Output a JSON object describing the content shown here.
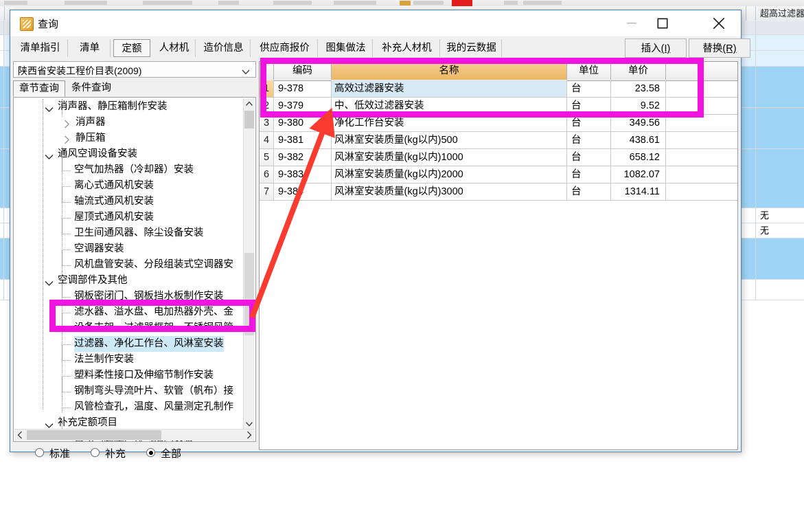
{
  "dialog": {
    "title": "查询",
    "window_buttons": {
      "minimize": "minimize-icon",
      "maximize": "maximize-icon",
      "close": "close-icon"
    },
    "tabs": [
      {
        "label": "清单指引",
        "active": false
      },
      {
        "label": "清单",
        "active": false
      },
      {
        "label": "定额",
        "active": true
      },
      {
        "label": "人材机",
        "active": false
      },
      {
        "label": "造价信息",
        "active": false
      },
      {
        "label": "供应商报价",
        "active": false
      },
      {
        "label": "图集做法",
        "active": false
      },
      {
        "label": "补充人材机",
        "active": false
      },
      {
        "label": "我的云数据",
        "active": false
      }
    ],
    "actions": [
      {
        "label": "插入",
        "accel": "(I)"
      },
      {
        "label": "替换",
        "accel": "(R)"
      }
    ]
  },
  "left_panel": {
    "catalog_select": {
      "value": "陕西省安装工程价目表(2009)",
      "arrow": "chevron-down-icon"
    },
    "sub_tabs": [
      {
        "label": "章节查询",
        "active": true
      },
      {
        "label": "条件查询",
        "active": false
      }
    ],
    "tree": [
      {
        "label": "消声器、静压箱制作安装",
        "indent": 1,
        "twist": "expanded",
        "leaf": false,
        "selected": false
      },
      {
        "label": "消声器",
        "indent": 2,
        "twist": "collapsed",
        "leaf": false,
        "selected": false
      },
      {
        "label": "静压箱",
        "indent": 2,
        "twist": "collapsed",
        "leaf": false,
        "selected": false
      },
      {
        "label": "通风空调设备安装",
        "indent": 1,
        "twist": "expanded",
        "leaf": false,
        "selected": false
      },
      {
        "label": "空气加热器（冷却器）安装",
        "indent": 2,
        "twist": "none",
        "leaf": true,
        "selected": false
      },
      {
        "label": "离心式通风机安装",
        "indent": 2,
        "twist": "none",
        "leaf": true,
        "selected": false
      },
      {
        "label": "轴流式通风机安装",
        "indent": 2,
        "twist": "none",
        "leaf": true,
        "selected": false
      },
      {
        "label": "屋顶式通风机安装",
        "indent": 2,
        "twist": "none",
        "leaf": true,
        "selected": false
      },
      {
        "label": "卫生间通风器、除尘设备安装",
        "indent": 2,
        "twist": "none",
        "leaf": true,
        "selected": false
      },
      {
        "label": "空调器安装",
        "indent": 2,
        "twist": "none",
        "leaf": true,
        "selected": false
      },
      {
        "label": "风机盘管安装、分段组装式空调器安",
        "indent": 2,
        "twist": "none",
        "leaf": true,
        "selected": false
      },
      {
        "label": "空调部件及其他",
        "indent": 1,
        "twist": "expanded",
        "leaf": false,
        "selected": false
      },
      {
        "label": "钢板密闭门、钢板挡水板制作安装",
        "indent": 2,
        "twist": "none",
        "leaf": true,
        "selected": false
      },
      {
        "label": "滤水器、溢水盘、电加热器外壳、金",
        "indent": 2,
        "twist": "none",
        "leaf": true,
        "selected": false
      },
      {
        "label": "设备支架、过滤器框架、不锈钢风管",
        "indent": 2,
        "twist": "none",
        "leaf": true,
        "selected": false
      },
      {
        "label": "过滤器、净化工作台、风淋室安装",
        "indent": 2,
        "twist": "none",
        "leaf": true,
        "selected": true
      },
      {
        "label": "法兰制作安装",
        "indent": 2,
        "twist": "none",
        "leaf": true,
        "selected": false
      },
      {
        "label": "塑料柔性接口及伸缩节制作安装",
        "indent": 2,
        "twist": "none",
        "leaf": true,
        "selected": false
      },
      {
        "label": "钢制弯头导流叶片、软管（帆布）接",
        "indent": 2,
        "twist": "none",
        "leaf": true,
        "selected": false
      },
      {
        "label": "风管检查孔，温度、风量测定孔制作",
        "indent": 2,
        "twist": "none",
        "leaf": true,
        "selected": false
      },
      {
        "label": "补充定额项目",
        "indent": 1,
        "twist": "expanded",
        "leaf": false,
        "selected": false
      },
      {
        "label": "自动（超压）排气活门安装",
        "indent": 2,
        "twist": "none",
        "leaf": true,
        "selected": false
      }
    ],
    "scroll": {
      "up_arrow": "chevron-up-icon",
      "down_arrow": "chevron-down-icon",
      "left_arrow": "chevron-left-icon",
      "right_arrow": "chevron-right-icon"
    },
    "filter_radios": [
      {
        "label": "标准",
        "checked": false
      },
      {
        "label": "补充",
        "checked": false
      },
      {
        "label": "全部",
        "checked": true
      }
    ]
  },
  "result_grid": {
    "columns": [
      "编码",
      "名称",
      "单位",
      "单价"
    ],
    "rows": [
      {
        "idx": "1",
        "code": "9-378",
        "name": "高效过滤器安装",
        "unit": "台",
        "price": "23.58",
        "highlight": true,
        "current": true
      },
      {
        "idx": "2",
        "code": "9-379",
        "name": "中、低效过滤器安装",
        "unit": "台",
        "price": "9.52",
        "highlight": false,
        "current": false
      },
      {
        "idx": "3",
        "code": "9-380",
        "name": "净化工作台安装",
        "unit": "台",
        "price": "349.56",
        "highlight": false,
        "current": false
      },
      {
        "idx": "4",
        "code": "9-381",
        "name": "风淋室安装质量(kg以内)500",
        "unit": "台",
        "price": "438.61",
        "highlight": false,
        "current": false
      },
      {
        "idx": "5",
        "code": "9-382",
        "name": "风淋室安装质量(kg以内)1000",
        "unit": "台",
        "price": "658.12",
        "highlight": false,
        "current": false
      },
      {
        "idx": "6",
        "code": "9-383",
        "name": "风淋室安装质量(kg以内)2000",
        "unit": "台",
        "price": "1082.07",
        "highlight": false,
        "current": false
      },
      {
        "idx": "7",
        "code": "9-384",
        "name": "风淋室安装质量(kg以内)3000",
        "unit": "台",
        "price": "1314.11",
        "highlight": false,
        "current": false
      }
    ]
  },
  "background": {
    "column_header": "超高过滤器",
    "cells": [
      "无",
      "无"
    ]
  },
  "annotations": {
    "highlight_color": "#f114e0",
    "arrow_color": "#fb3b30",
    "boxes": [
      {
        "name": "result-rows-highlight"
      },
      {
        "name": "tree-item-highlight"
      }
    ],
    "arrow": {
      "name": "pointer-arrow"
    }
  }
}
